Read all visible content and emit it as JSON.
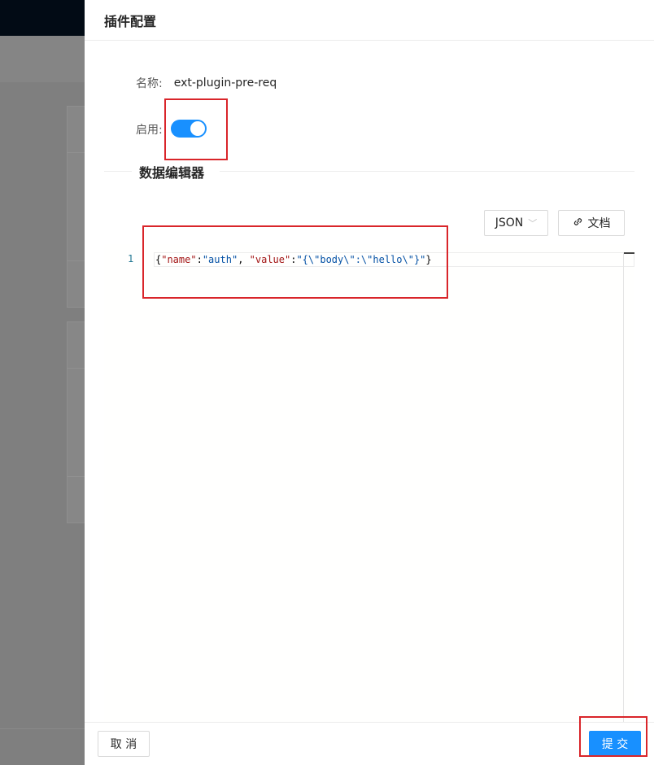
{
  "drawer": {
    "title": "插件配置",
    "name_label": "名称:",
    "name_value": "ext-plugin-pre-req",
    "enable_label": "启用:",
    "enabled": true,
    "section_title": "数据编辑器"
  },
  "toolbar": {
    "format_select": "JSON",
    "docs_button": "文档"
  },
  "editor": {
    "line_number": "1",
    "tokens": {
      "open": "{",
      "k1": "\"name\"",
      "c1": ":",
      "v1": "\"auth\"",
      "sep": ", ",
      "k2": "\"value\"",
      "c2": ":",
      "v2": "\"{\\\"body\\\":\\\"hello\\\"}\"",
      "close": "}"
    }
  },
  "footer": {
    "cancel_label": "取 消",
    "submit_label": "提 交"
  },
  "colors": {
    "primary": "#1890ff",
    "annotation": "#d9252a"
  }
}
